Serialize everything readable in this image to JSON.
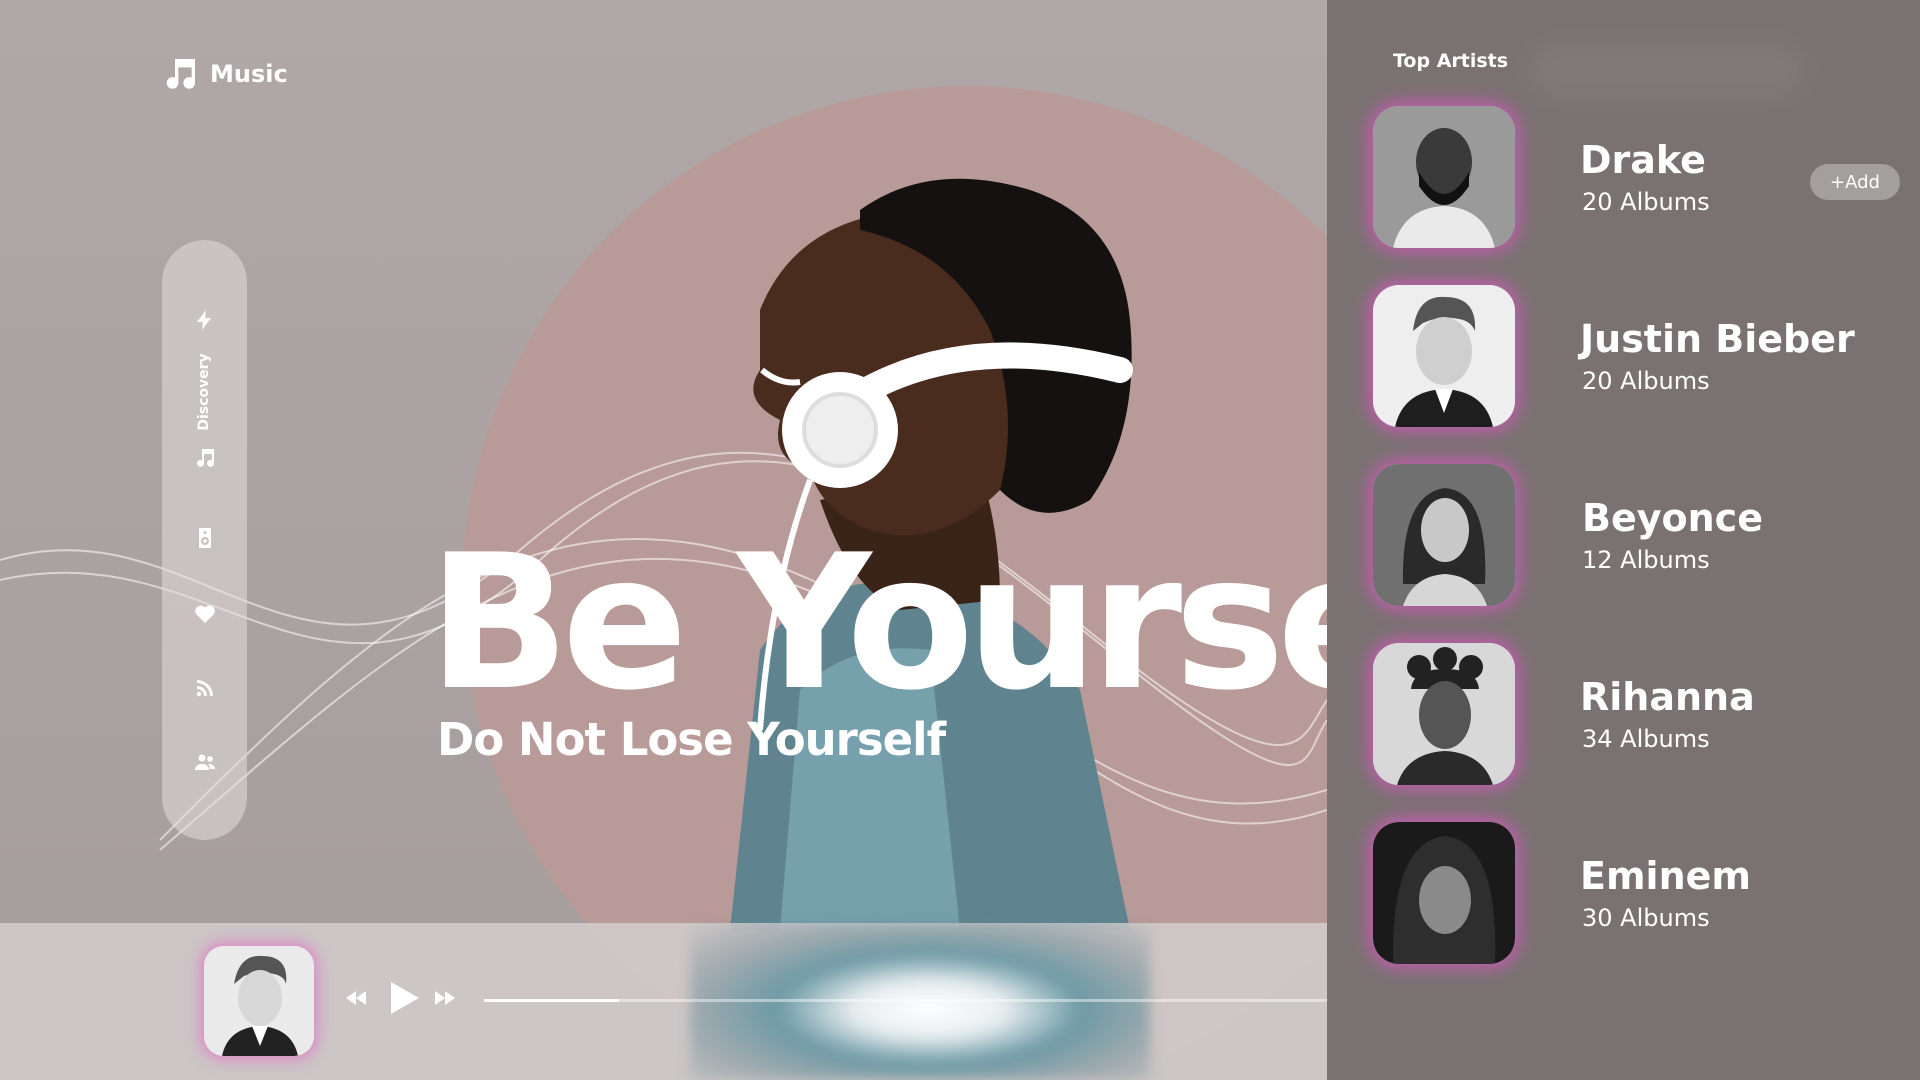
{
  "brand": {
    "name": "Music",
    "icon": "music-note-icon"
  },
  "hero": {
    "title": "Be Yourse",
    "subtitle": "Do Not Lose Yourself"
  },
  "sidenav": {
    "label": "Discovery",
    "items": [
      {
        "icon": "lightning-icon"
      },
      {
        "icon": "music-note-icon"
      },
      {
        "icon": "speaker-icon"
      },
      {
        "icon": "heart-icon"
      },
      {
        "icon": "rss-icon"
      },
      {
        "icon": "users-icon"
      }
    ]
  },
  "player": {
    "progress": 0.16,
    "controls": [
      "rewind-icon",
      "play-icon",
      "fast-forward-icon"
    ]
  },
  "panel": {
    "title": "Top Artists",
    "add_label": "+Add",
    "artists": [
      {
        "name": "Drake",
        "albums": "20 Albums"
      },
      {
        "name": "Justin Bieber",
        "albums": "20 Albums"
      },
      {
        "name": "Beyonce",
        "albums": "12 Albums"
      },
      {
        "name": "Rihanna",
        "albums": "34 Albums"
      },
      {
        "name": "Eminem",
        "albums": "30 Albums"
      }
    ]
  },
  "colors": {
    "background": "#aba3a3",
    "circle": "#b89a98",
    "panel": "#7a7272",
    "glow": "#ec50d2",
    "text": "#ffffff"
  }
}
